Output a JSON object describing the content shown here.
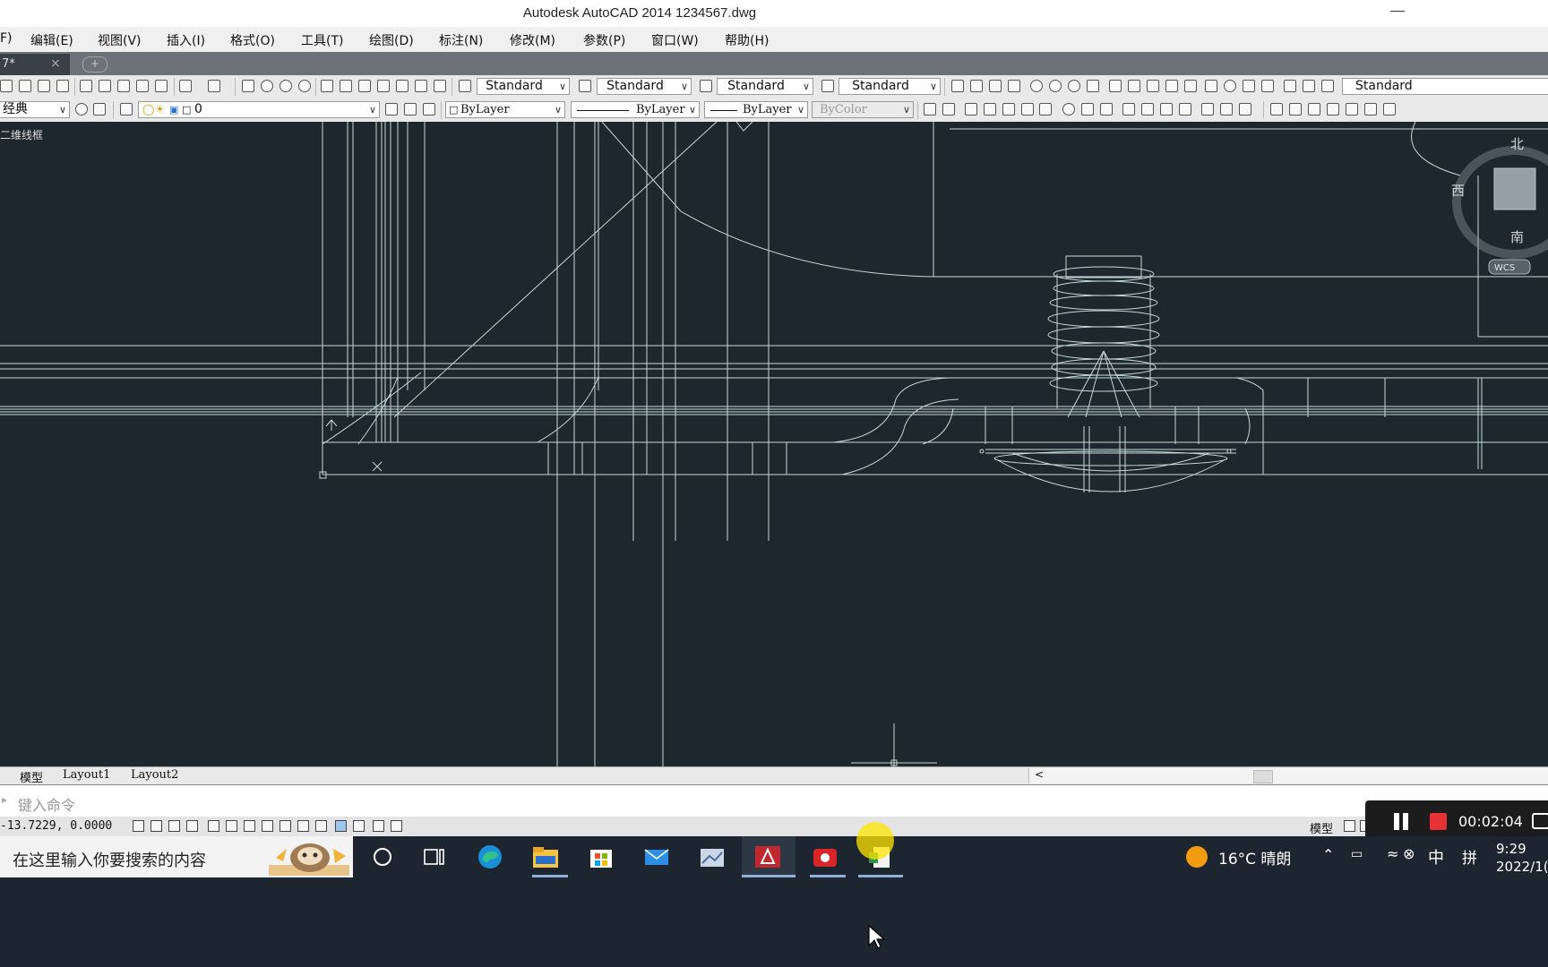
{
  "window": {
    "title": "Autodesk AutoCAD 2014     1234567.dwg"
  },
  "menu": [
    "F)",
    "编辑(E)",
    "视图(V)",
    "插入(I)",
    "格式(O)",
    "工具(T)",
    "绘图(D)",
    "标注(N)",
    "修改(M)",
    "参数(P)",
    "窗口(W)",
    "帮助(H)"
  ],
  "doc_tab": {
    "label": "7*",
    "close": "×",
    "new": "+"
  },
  "toolbar1": {
    "text_style": "Standard",
    "dim_style": "Standard",
    "table_style": "Standard",
    "multileader_style": "Standard",
    "extra_style": "Standard"
  },
  "toolbar2": {
    "workspace": "经典",
    "layer": "0",
    "color": "ByLayer",
    "linetype": "ByLayer",
    "lineweight": "ByLayer",
    "plotstyle": "ByColor"
  },
  "viewport": {
    "view_label": "二维线框",
    "viewcube": {
      "north": "北",
      "south": "南",
      "west": "西",
      "ucs": "WCS"
    },
    "colors": {
      "background": "#1f272e",
      "lines": "#d8ece8"
    }
  },
  "layout_tabs": [
    "模型",
    "Layout1",
    "Layout2"
  ],
  "command": {
    "placeholder": "键入命令"
  },
  "status": {
    "coords": "-13.7229, 0.0000",
    "model": "模型"
  },
  "recorder": {
    "time": "00:02:04"
  },
  "taskbar": {
    "search_placeholder": "在这里输入你要搜索的内容",
    "weather": "16°C  晴朗",
    "ime": "中",
    "ime2": "拼",
    "time": "9:29",
    "date": "2022/1("
  }
}
